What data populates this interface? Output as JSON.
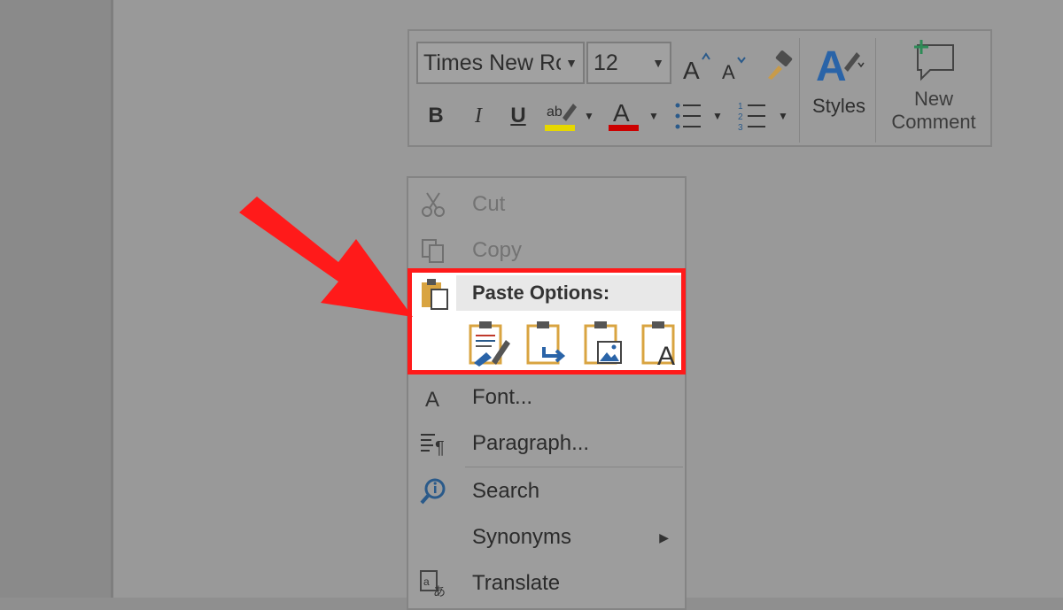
{
  "mini_toolbar": {
    "font_name": "Times New Rc",
    "font_size": "12",
    "styles_label": "Styles",
    "new_comment_label_line1": "New",
    "new_comment_label_line2": "Comment",
    "highlight_color": "#e6d800",
    "font_color": "#cc0000"
  },
  "context_menu": {
    "items": [
      {
        "label": "Cut",
        "icon": "scissors-icon",
        "enabled": false
      },
      {
        "label": "Copy",
        "icon": "copy-icon",
        "enabled": false
      },
      {
        "label": "Paste Options:",
        "icon": "clipboard-icon",
        "enabled": true
      },
      {
        "label": "Font...",
        "icon": "font-a-icon",
        "enabled": true
      },
      {
        "label": "Paragraph...",
        "icon": "paragraph-icon",
        "enabled": true
      },
      {
        "label": "Search",
        "icon": "search-info-icon",
        "enabled": true
      },
      {
        "label": "Synonyms",
        "icon": "",
        "enabled": true
      },
      {
        "label": "Translate",
        "icon": "translate-icon",
        "enabled": true
      }
    ],
    "paste_options": [
      {
        "name": "keep-source-formatting"
      },
      {
        "name": "merge-formatting"
      },
      {
        "name": "picture"
      },
      {
        "name": "keep-text-only"
      }
    ]
  },
  "annotation": {
    "highlight_color": "#ff1a1a"
  }
}
